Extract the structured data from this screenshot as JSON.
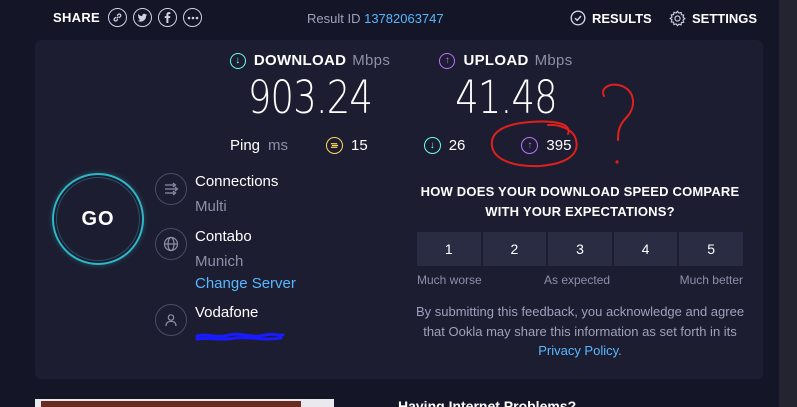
{
  "topbar": {
    "share_label": "SHARE",
    "share_icons": [
      "link-icon",
      "twitter-icon",
      "facebook-icon",
      "more-icon"
    ],
    "result_id_label": "Result ID",
    "result_id": "13782063747",
    "results_label": "RESULTS",
    "settings_label": "SETTINGS"
  },
  "speed": {
    "download": {
      "label": "DOWNLOAD",
      "unit": "Mbps",
      "value": "903.24"
    },
    "upload": {
      "label": "UPLOAD",
      "unit": "Mbps",
      "value": "41.48"
    }
  },
  "ping": {
    "label": "Ping",
    "unit": "ms",
    "idle": "15",
    "download": "26",
    "upload": "395"
  },
  "go_label": "GO",
  "connections": {
    "title": "Connections",
    "mode": "Multi"
  },
  "server": {
    "name": "Contabo",
    "location": "Munich",
    "change_label": "Change Server"
  },
  "provider": {
    "name": "Vodafone"
  },
  "feedback": {
    "question": "HOW DOES YOUR DOWNLOAD SPEED COMPARE WITH YOUR EXPECTATIONS?",
    "ratings": [
      "1",
      "2",
      "3",
      "4",
      "5"
    ],
    "low_label": "Much worse",
    "mid_label": "As expected",
    "high_label": "Much better",
    "note_prefix": "By submitting this feedback, you acknowledge and agree that Ookla may share this information as set forth in its",
    "privacy_link": "Privacy Policy",
    "note_suffix": "."
  },
  "bottom": {
    "heading": "Having Internet Problems?"
  },
  "colors": {
    "background": "#141526",
    "panel": "#1c1d30",
    "download_accent": "#6afff3",
    "upload_accent": "#bf71ff",
    "ping_accent": "#ffd85c",
    "link": "#58b7ff",
    "annotation": "#e0201c"
  }
}
